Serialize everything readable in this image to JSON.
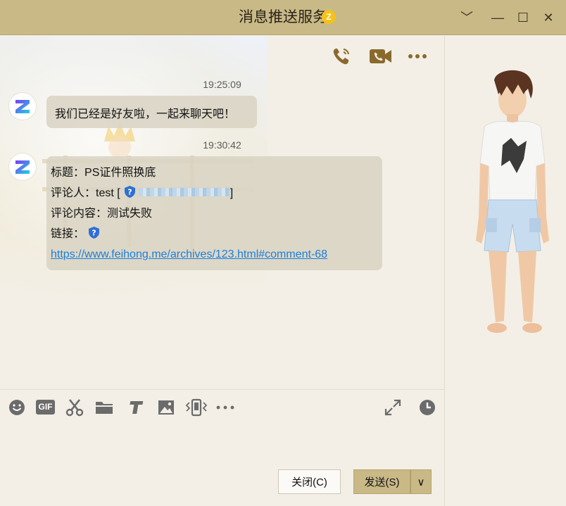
{
  "window": {
    "title": "消息推送服务",
    "badge": "Z",
    "minimize": "﹀",
    "restore": "—",
    "maximize": "☐",
    "close": "✕"
  },
  "chat": {
    "top_actions": [
      "voice-call",
      "video-call",
      "more"
    ],
    "messages": [
      {
        "time": "19:25:09",
        "text": "我们已经是好友啦，一起来聊天吧！"
      },
      {
        "time": "19:30:42",
        "title_label": "标题：",
        "title_value": "PS证件照换底",
        "commenter_label": "评论人：",
        "commenter_value": "test [",
        "commenter_suffix": "]",
        "content_label": "评论内容：",
        "content_value": "测试失败",
        "link_label": "链接：",
        "url": "https://www.feihong.me/archives/123.html#comment-68"
      }
    ]
  },
  "toolbar": {
    "items": [
      "emoji",
      "gif",
      "screenshot",
      "file",
      "document",
      "image",
      "shake",
      "more",
      "expand",
      "history"
    ],
    "gif_label": "GIF"
  },
  "buttons": {
    "close_label": "关闭(C)",
    "send_label": "发送(S)",
    "send_menu": "∨"
  },
  "colors": {
    "titlebar": "#c9b987",
    "background": "#f3efe6",
    "accent_icon": "#8a6a2c",
    "link": "#1b7fd9",
    "shield": "#2f6fd6"
  }
}
